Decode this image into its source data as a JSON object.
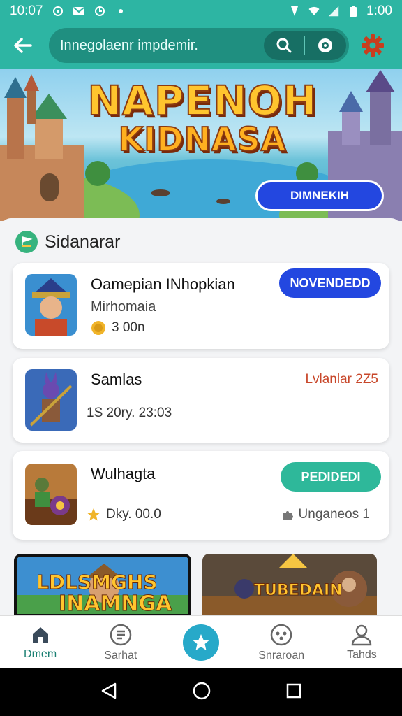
{
  "status_bar": {
    "time_left": "10:07",
    "time_right": "1:00"
  },
  "app_bar": {
    "search_text": "Innegolaenr impdemir."
  },
  "banner": {
    "title_line1": "NAPENOH",
    "title_line2": "KIDNASA",
    "button_label": "DIMNEKIH"
  },
  "section": {
    "title": "Sidanarar"
  },
  "cards": [
    {
      "title": "Oamepian INhopkian",
      "subtitle": "Mirhomaia",
      "meta": "3 00n",
      "action": "NOVENDEDD",
      "action_color": "#2347e0"
    },
    {
      "title": "Samlas",
      "tag": "Lvlanlar 2Z5",
      "meta": "1S 20ry. 23:03"
    },
    {
      "title": "Wulhagta",
      "action": "PEDIDEDI",
      "action_color": "#2eb89a",
      "meta": "Dky. 00.0",
      "meta2": "Unganeos 1"
    }
  ],
  "promos": [
    {
      "line1": "LDLSMGHS",
      "line2": "INAMNGA"
    },
    {
      "label": "TUBEDAIN"
    }
  ],
  "bottom_nav": {
    "items": [
      {
        "label": "Dmem",
        "icon": "home-icon"
      },
      {
        "label": "Sarhat",
        "icon": "search-list-icon"
      },
      {
        "label": "",
        "icon": "star-icon"
      },
      {
        "label": "Snraroan",
        "icon": "gamepad-icon"
      },
      {
        "label": "Tahds",
        "icon": "profile-icon"
      }
    ]
  },
  "colors": {
    "accent": "#2db5a3",
    "primary_blue": "#2347e0",
    "teal_pill": "#2eb89a"
  }
}
